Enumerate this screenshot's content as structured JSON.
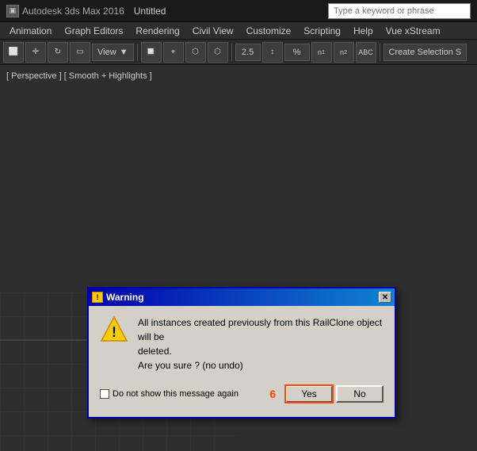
{
  "titlebar": {
    "app_name": "Autodesk 3ds Max 2016",
    "document_name": "Untitled",
    "search_placeholder": "Type a keyword or phrase"
  },
  "menubar": {
    "items": [
      "Animation",
      "Graph Editors",
      "Rendering",
      "Civil View",
      "Customize",
      "Scripting",
      "Help",
      "Vue xStream"
    ]
  },
  "toolbar": {
    "view_label": "View",
    "num1": "2.5",
    "num2": "%",
    "create_selection_label": "Create Selection S"
  },
  "viewport": {
    "label": "[ Perspective ] [ Smooth + Highlights ]"
  },
  "dialog": {
    "title": "Warning",
    "close_btn": "✕",
    "message_line1": "All instances created previously from this RailClone object will be",
    "message_line2": "deleted.",
    "message_line3": "Are you sure ? (no undo)",
    "checkbox_label": "Do not show this message again",
    "number": "6",
    "yes_btn": "Yes",
    "no_btn": "No"
  }
}
